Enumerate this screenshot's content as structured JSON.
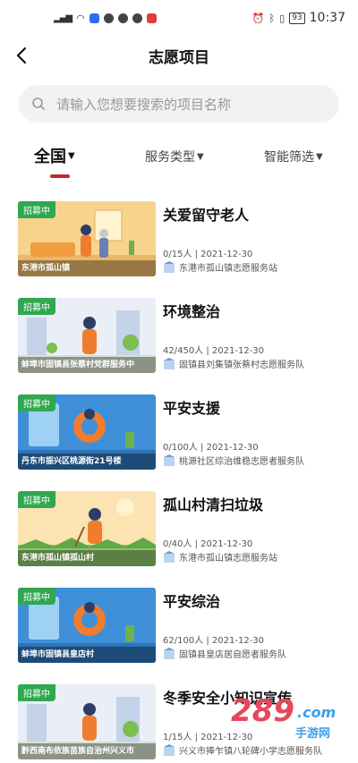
{
  "status_bar": {
    "signal": "⁴ᴳ.ıl",
    "battery": "93",
    "time": "10:37"
  },
  "header": {
    "title": "志愿项目"
  },
  "search": {
    "placeholder": "请输入您想要搜索的项目名称"
  },
  "filters": [
    {
      "label": "全国",
      "active": true
    },
    {
      "label": "服务类型",
      "active": false
    },
    {
      "label": "智能筛选",
      "active": false
    }
  ],
  "items": [
    {
      "badge": "招募中",
      "caption": "东港市孤山镇",
      "title": "关爱留守老人",
      "meta": "0/15人 | 2021-12-30",
      "org": "东港市孤山镇志愿服务站"
    },
    {
      "badge": "招募中",
      "caption": "蚌埠市固镇县张蔡村党群服务中",
      "title": "环境整治",
      "meta": "42/450人 | 2021-12-30",
      "org": "固镇县刘集镇张蔡村志愿服务队"
    },
    {
      "badge": "招募中",
      "caption": "丹东市振兴区桃源街21号楼",
      "title": "平安支援",
      "meta": "0/100人 | 2021-12-30",
      "org": "桃源社区综治维稳志愿者服务队"
    },
    {
      "badge": "招募中",
      "caption": "东港市孤山镇孤山村",
      "title": "孤山村清扫垃圾",
      "meta": "0/40人 | 2021-12-30",
      "org": "东港市孤山镇志愿服务站"
    },
    {
      "badge": "招募中",
      "caption": "蚌埠市固镇县皇店村",
      "title": "平安综治",
      "meta": "62/100人 | 2021-12-30",
      "org": "固镇县皇店居自愿者服务队"
    },
    {
      "badge": "招募中",
      "caption": "黔西南布依族苗族自治州兴义市",
      "title": "冬季安全小知识宣传",
      "meta": "1/15人 | 2021-12-30",
      "org": "兴义市捧乍镇八轮碑小学志愿服务队"
    }
  ],
  "watermark": {
    "text": "289",
    "suffix": ".com",
    "sub": "手游网"
  },
  "colors": {
    "accent_red": "#c9252c",
    "badge_green": "#2fa84f"
  }
}
